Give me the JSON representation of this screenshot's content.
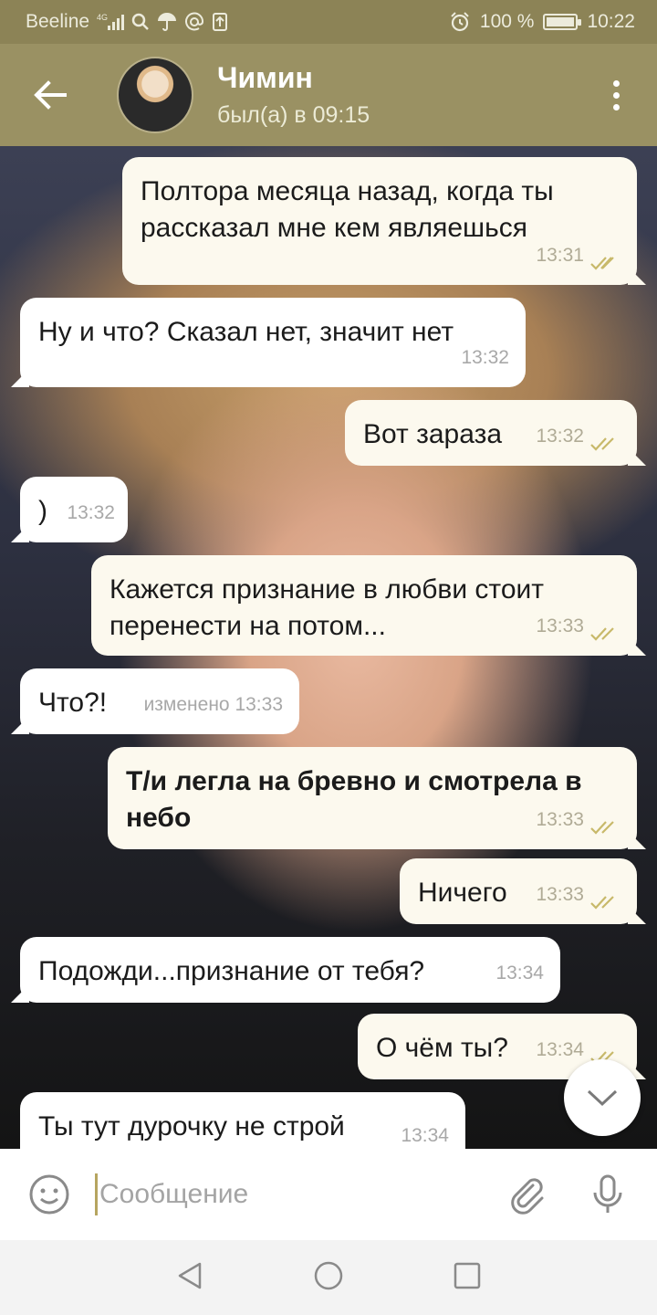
{
  "status_bar": {
    "carrier": "Beeline",
    "network": "4G",
    "battery_percent": "100 %",
    "battery_level": 1.0,
    "time": "10:22",
    "icons": [
      "signal-icon",
      "search-icon",
      "umbrella-icon",
      "at-icon",
      "upload-icon",
      "alarm-icon",
      "battery-icon"
    ]
  },
  "header": {
    "name": "Чимин",
    "last_seen": "был(а) в 09:15",
    "back_icon": "arrow-left-icon",
    "menu_icon": "more-vertical-icon"
  },
  "messages": [
    {
      "dir": "out",
      "text": "Полтора месяца назад, когда ты рассказал мне кем являешься",
      "time": "13:31",
      "read": true
    },
    {
      "dir": "in",
      "text": "Ну и что? Сказал нет, значит нет",
      "time": "13:32"
    },
    {
      "dir": "out",
      "text": "Вот зараза",
      "time": "13:32",
      "read": true
    },
    {
      "dir": "in",
      "text": ")",
      "time": "13:32"
    },
    {
      "dir": "out",
      "text": "Кажется признание в любви стоит перенести на потом...",
      "time": "13:33",
      "read": true
    },
    {
      "dir": "in",
      "text": "Что?!",
      "time": "изменено 13:33"
    },
    {
      "dir": "out",
      "text": "Т/и легла на бревно и смотрела в небо",
      "time": "13:33",
      "read": true,
      "bold": true
    },
    {
      "dir": "out",
      "text": "Ничего",
      "time": "13:33",
      "read": true
    },
    {
      "dir": "in",
      "text": "Подожди...признание от тебя?",
      "time": "13:34"
    },
    {
      "dir": "out",
      "text": "О чём ты?",
      "time": "13:34",
      "read": true
    },
    {
      "dir": "in",
      "text": "Ты тут дурочку не строй",
      "time": "13:34"
    }
  ],
  "composer": {
    "placeholder": "Сообщение",
    "emoji_icon": "emoji-icon",
    "attach_icon": "paperclip-icon",
    "mic_icon": "microphone-icon"
  },
  "nav": {
    "back_icon": "nav-back-icon",
    "home_icon": "nav-home-icon",
    "recents_icon": "nav-recents-icon"
  },
  "colors": {
    "header": "#9a9163",
    "status_bar": "#8c8356",
    "bubble_out": "#fcf9ee",
    "bubble_in": "#ffffff",
    "read_check": "#c8b96a"
  }
}
